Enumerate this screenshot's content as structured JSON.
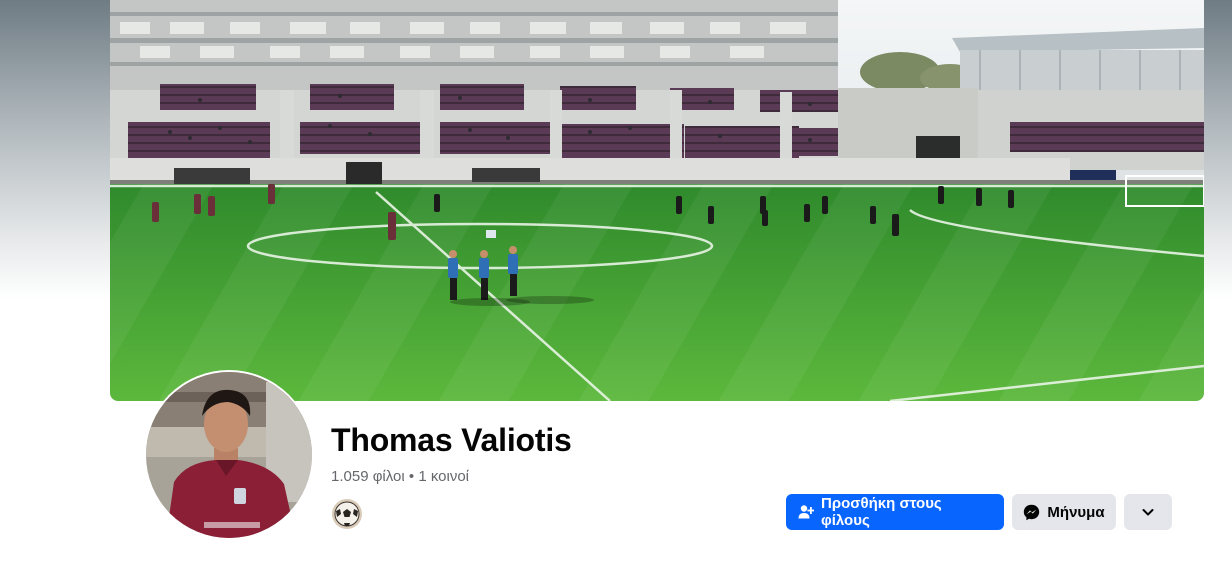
{
  "profile": {
    "name": "Thomas Valiotis",
    "friends_count": "1.059 φίλοι",
    "separator": "•",
    "mutual_friends": "1 κοινοί"
  },
  "actions": {
    "add_friend_label": "Προσθήκη στους φίλους",
    "message_label": "Μήνυμα"
  },
  "icons": {
    "add_friend": "add-friend-icon",
    "message": "messenger-icon",
    "more": "chevron-down-icon"
  },
  "colors": {
    "primary_button": "#0866ff",
    "secondary_button": "#e4e6eb",
    "name_text": "#050505",
    "secondary_text": "#65676b"
  }
}
